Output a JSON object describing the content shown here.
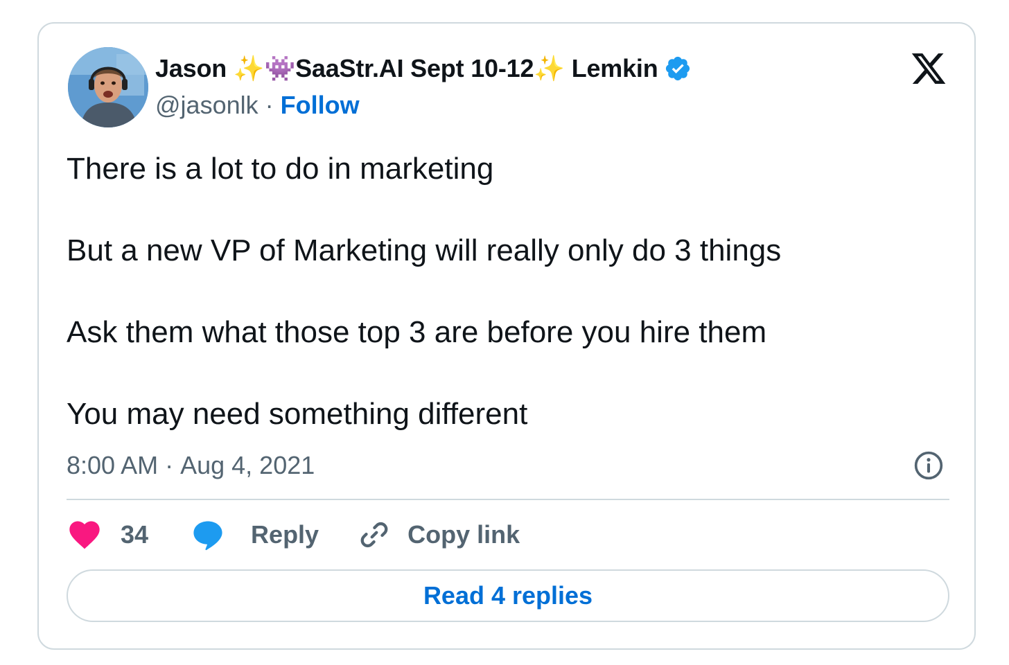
{
  "tweet": {
    "author": {
      "display_name": "Jason ✨👾SaaStr.AI Sept 10-12✨ Lemkin",
      "handle": "@jasonlk",
      "separator": "·",
      "follow_label": "Follow",
      "verified": true,
      "verified_color": "#1d9bf0",
      "avatar_icon": "profile-photo"
    },
    "platform_icon": "x-logo-icon",
    "text_lines": [
      "There is a lot to do in marketing",
      "But a new VP of Marketing will really only do 3 things",
      "Ask them what those top 3 are before you hire them",
      "You may need something different"
    ],
    "timestamp": {
      "time": "8:00 AM",
      "separator": "·",
      "date": "Aug 4, 2021"
    },
    "actions": {
      "like_count": "34",
      "like_color": "#f91880",
      "reply_label": "Reply",
      "reply_color": "#1d9bf0",
      "copy_link_label": "Copy link"
    },
    "read_replies_label": "Read 4 replies",
    "colors": {
      "link_blue": "#006fd6",
      "muted_text": "#536471",
      "border": "#cfd9de",
      "text": "#0f1419"
    }
  }
}
